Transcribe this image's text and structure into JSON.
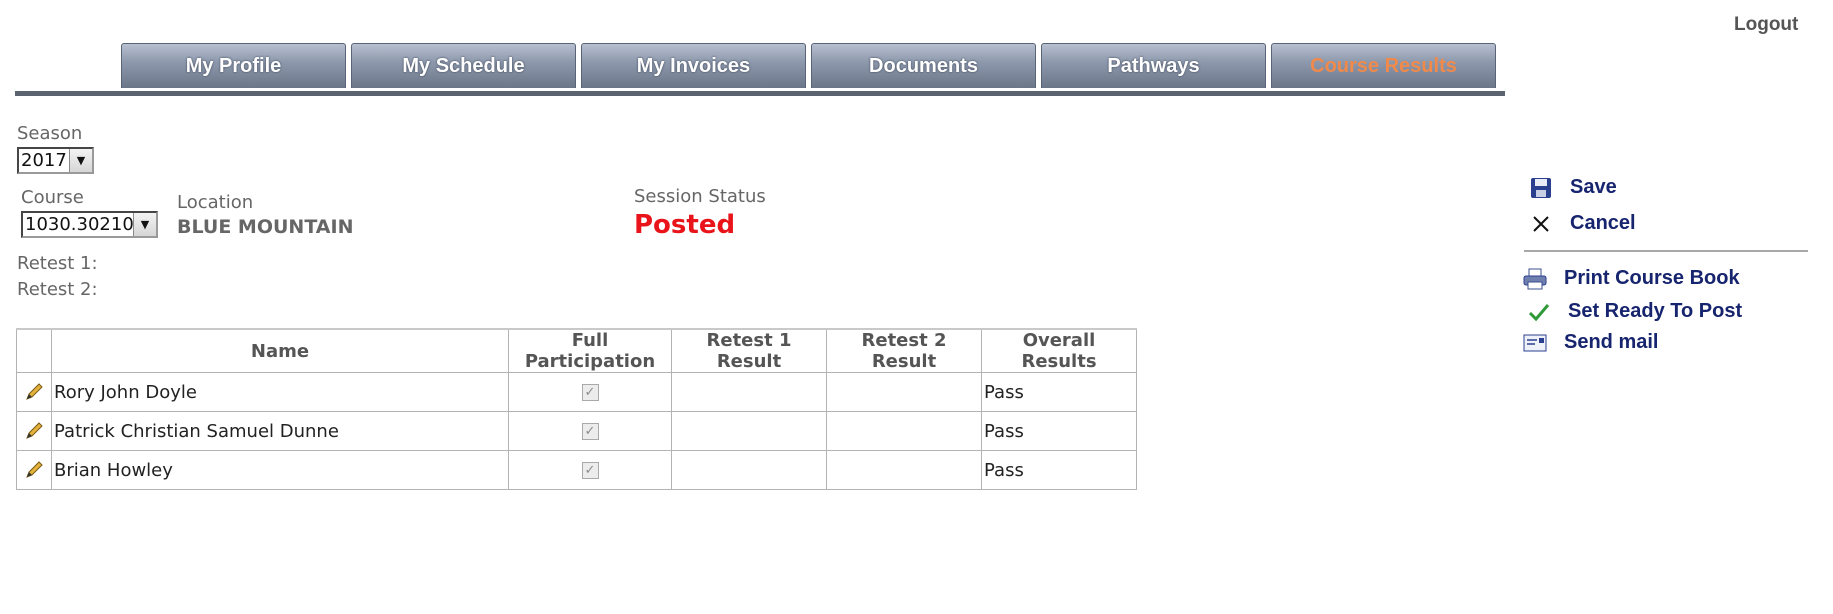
{
  "header": {
    "logout_label": "Logout"
  },
  "tabs": [
    {
      "label": "My Profile"
    },
    {
      "label": "My Schedule"
    },
    {
      "label": "My Invoices"
    },
    {
      "label": "Documents"
    },
    {
      "label": "Pathways"
    },
    {
      "label": "Course Results",
      "active": true
    }
  ],
  "form": {
    "season_label": "Season",
    "season_value": "2017",
    "course_label": "Course",
    "course_value": "1030.30210",
    "location_label": "Location",
    "location_value": "BLUE MOUNTAIN",
    "session_status_label": "Session Status",
    "session_status_value": "Posted",
    "retest1_label": "Retest 1:",
    "retest2_label": "Retest 2:"
  },
  "table": {
    "columns": [
      "",
      "Name",
      "Full Participation",
      "Retest 1 Result",
      "Retest 2 Result",
      "Overall Results"
    ],
    "rows": [
      {
        "name": "Rory John Doyle",
        "full_participation": true,
        "retest1": "",
        "retest2": "",
        "overall": "Pass"
      },
      {
        "name": "Patrick Christian Samuel Dunne",
        "full_participation": true,
        "retest1": "",
        "retest2": "",
        "overall": "Pass"
      },
      {
        "name": "Brian Howley",
        "full_participation": true,
        "retest1": "",
        "retest2": "",
        "overall": "Pass"
      }
    ]
  },
  "actions": {
    "save_label": "Save",
    "cancel_label": "Cancel",
    "print_label": "Print Course Book",
    "ready_label": "Set Ready To Post",
    "mail_label": "Send mail"
  },
  "icons": {
    "save": "floppy-disk-icon",
    "cancel": "close-icon",
    "print": "printer-icon",
    "ready": "checkmark-icon",
    "mail": "envelope-icon",
    "edit": "pencil-icon"
  },
  "colors": {
    "status": "#e8141a",
    "active_tab": "#f08a4b",
    "action_link": "#17246e"
  }
}
